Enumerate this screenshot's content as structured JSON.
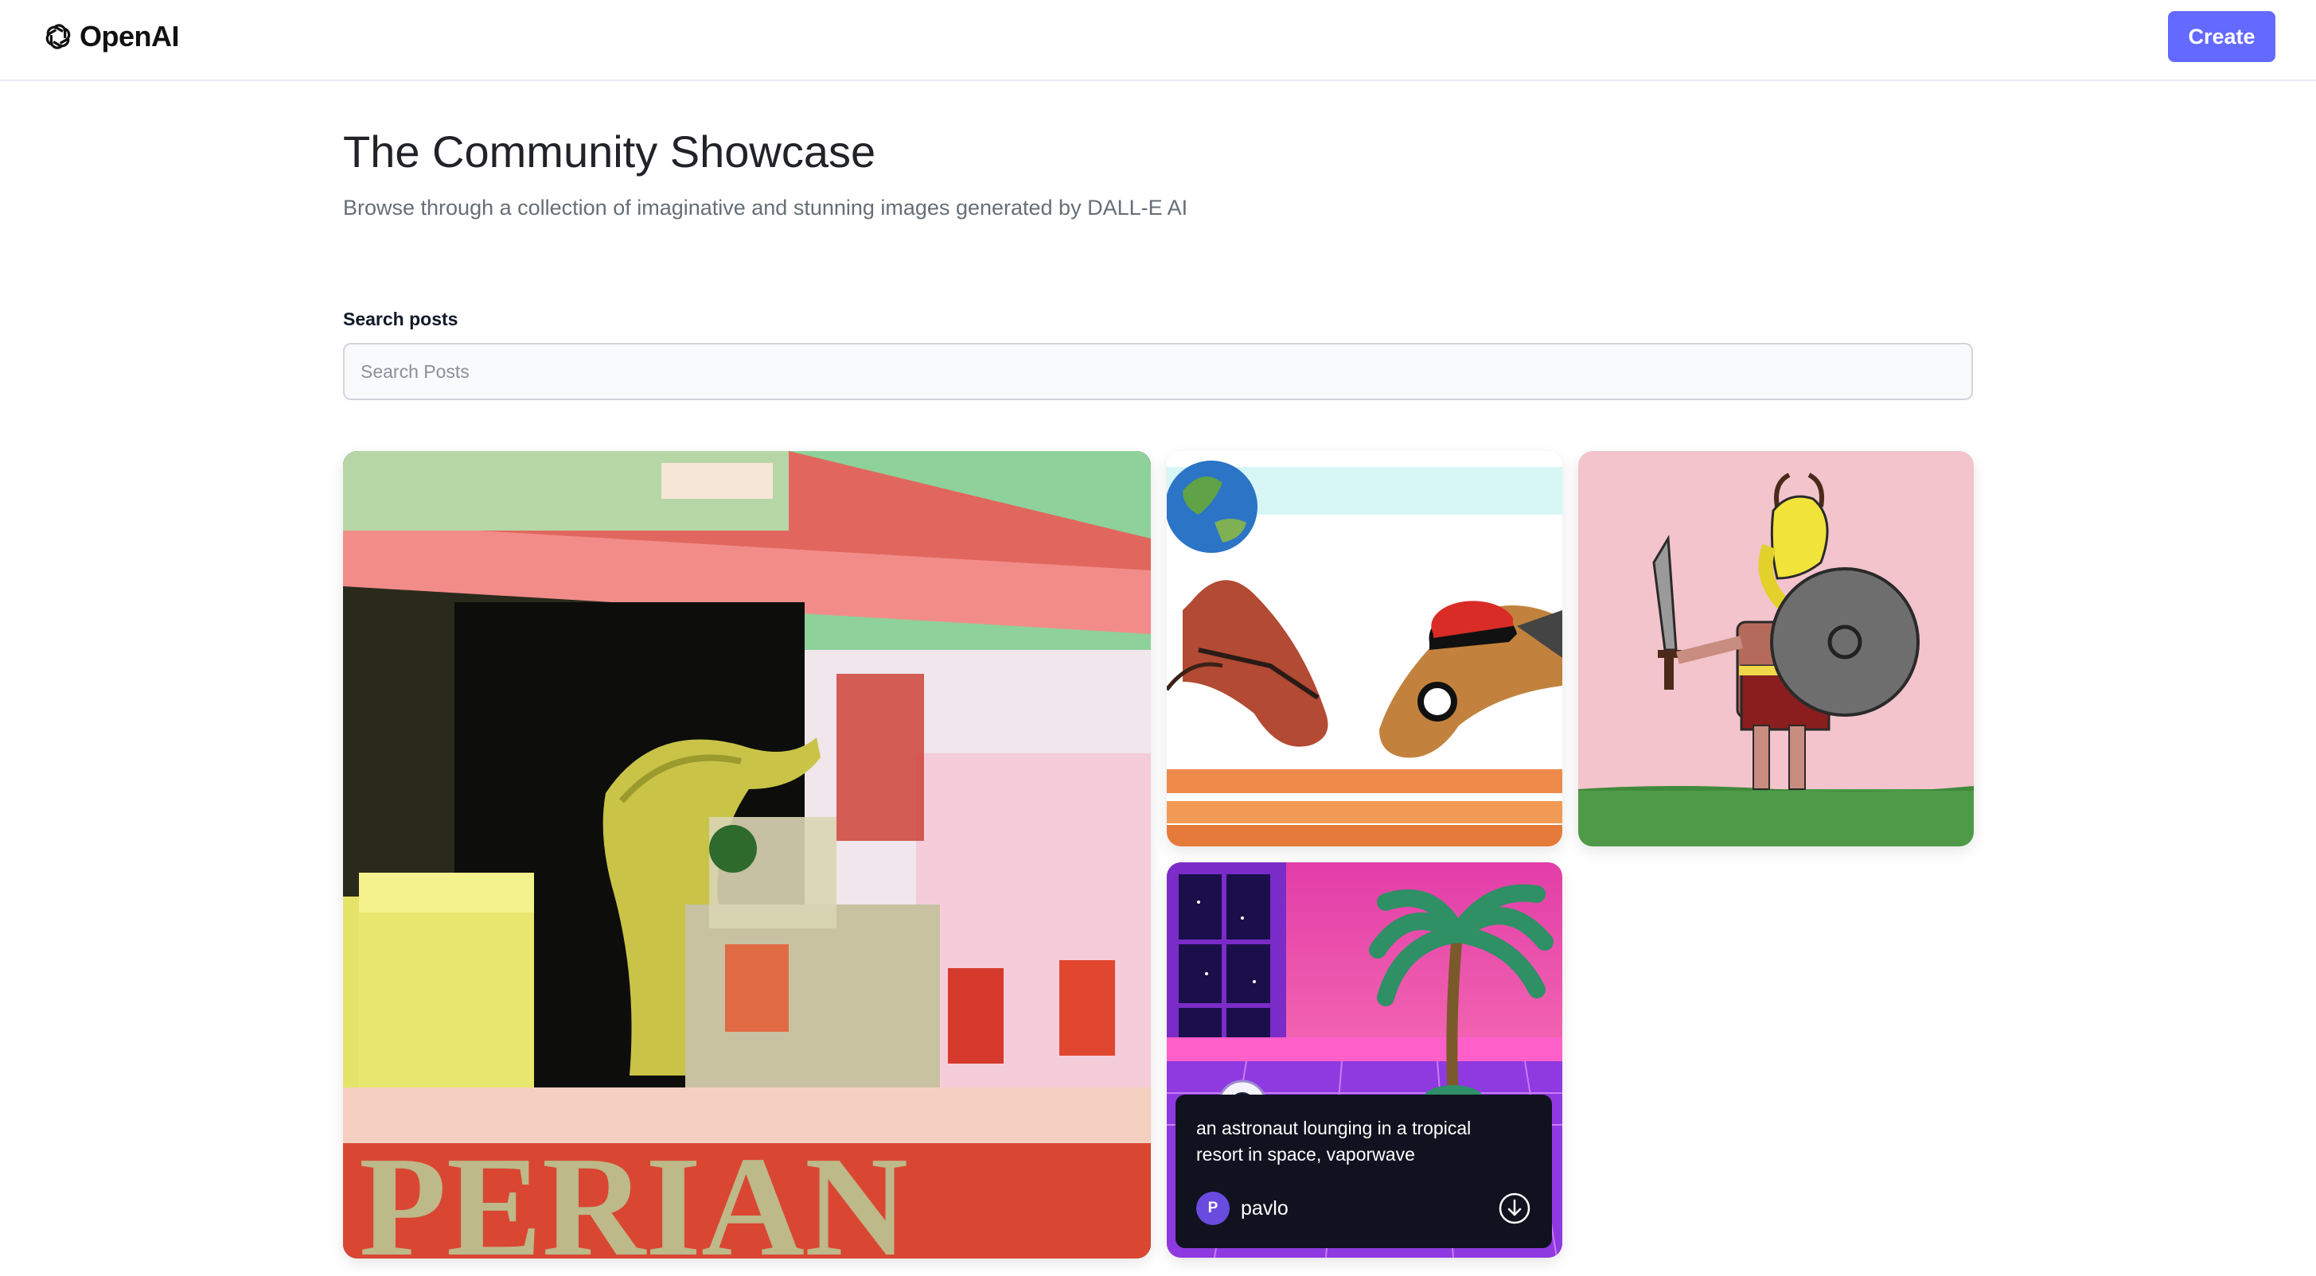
{
  "header": {
    "logo_text": "OpenAI",
    "logo_icon": "openai-logo-icon",
    "create_label": "Create",
    "accent_color": "#6469ff"
  },
  "main": {
    "title": "The Community Showcase",
    "subtitle": "Browse through a collection of imaginative and stunning images generated by DALL-E AI"
  },
  "search": {
    "label": "Search posts",
    "placeholder": "Search Posts",
    "value": ""
  },
  "posts": [
    {
      "image": "dinosaur-lemonade-stand-image",
      "banner_text": "PERIAN"
    },
    {
      "image": "horses-and-earth-image"
    },
    {
      "image": "banana-warrior-image"
    },
    {
      "image": "astronaut-vaporwave-image",
      "prompt": "an astronaut lounging in a tropical resort in space, vaporwave",
      "user_initial": "P",
      "user_name": "pavlo",
      "download_icon": "download-icon"
    }
  ]
}
